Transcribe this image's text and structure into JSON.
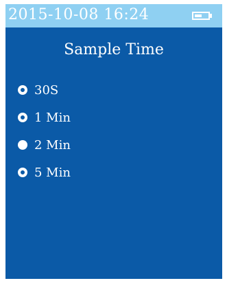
{
  "status_bar": {
    "datetime": "2015-10-08  16:24",
    "battery_level": 0.55,
    "battery_icon": "battery-icon"
  },
  "page": {
    "title": "Sample Time"
  },
  "options": [
    {
      "label": "30S",
      "selected": false
    },
    {
      "label": "1 Min",
      "selected": false
    },
    {
      "label": "2 Min",
      "selected": true
    },
    {
      "label": "5 Min",
      "selected": false
    }
  ],
  "colors": {
    "screen_background": "#0b5aa7",
    "status_bar_background": "#8fd0f2",
    "text": "#ffffff"
  }
}
